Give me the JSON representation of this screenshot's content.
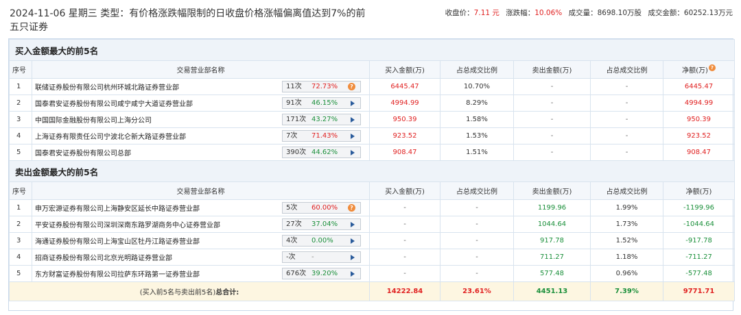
{
  "header": {
    "title": "2024-11-06 星期三 类型：有价格涨跌幅限制的日收盘价格涨幅偏离值达到7%的前五只证券",
    "close_label": "收盘价：",
    "close_value": "7.11 元",
    "change_label": "涨跌幅：",
    "change_value": "10.06%",
    "volume_label": "成交量：",
    "volume_value": "8698.10万股",
    "amount_label": "成交金额：",
    "amount_value": "60252.13万元"
  },
  "columns": {
    "idx": "序号",
    "dept": "交易营业部名称",
    "buy": "买入金额(万)",
    "buy_ratio": "占总成交比例",
    "sell": "卖出金额(万)",
    "sell_ratio": "占总成交比例",
    "net": "净额(万)"
  },
  "buy_section": {
    "title": "买入金额最大的前5名",
    "rows": [
      {
        "idx": "1",
        "dept": "联储证券股份有限公司杭州环城北路证券营业部",
        "cnt": "11次",
        "pct": "72.73%",
        "buy": "6445.47",
        "buy_ratio": "10.70%",
        "sell": "-",
        "sell_ratio": "-",
        "net": "6445.47"
      },
      {
        "idx": "2",
        "dept": "国泰君安证券股份有限公司咸宁咸宁大道证券营业部",
        "cnt": "91次",
        "pct": "46.15%",
        "buy": "4994.99",
        "buy_ratio": "8.29%",
        "sell": "-",
        "sell_ratio": "-",
        "net": "4994.99"
      },
      {
        "idx": "3",
        "dept": "中国国际金融股份有限公司上海分公司",
        "cnt": "171次",
        "pct": "43.27%",
        "buy": "950.39",
        "buy_ratio": "1.58%",
        "sell": "-",
        "sell_ratio": "-",
        "net": "950.39"
      },
      {
        "idx": "4",
        "dept": "上海证券有限责任公司宁波北仑新大路证券营业部",
        "cnt": "7次",
        "pct": "71.43%",
        "buy": "923.52",
        "buy_ratio": "1.53%",
        "sell": "-",
        "sell_ratio": "-",
        "net": "923.52"
      },
      {
        "idx": "5",
        "dept": "国泰君安证券股份有限公司总部",
        "cnt": "390次",
        "pct": "44.62%",
        "buy": "908.47",
        "buy_ratio": "1.51%",
        "sell": "-",
        "sell_ratio": "-",
        "net": "908.47"
      }
    ]
  },
  "sell_section": {
    "title": "卖出金额最大的前5名",
    "rows": [
      {
        "idx": "1",
        "dept": "申万宏源证券有限公司上海静安区延长中路证券营业部",
        "cnt": "5次",
        "pct": "60.00%",
        "buy": "-",
        "buy_ratio": "-",
        "sell": "1199.96",
        "sell_ratio": "1.99%",
        "net": "-1199.96"
      },
      {
        "idx": "2",
        "dept": "平安证券股份有限公司深圳深南东路罗湖商务中心证券营业部",
        "cnt": "27次",
        "pct": "37.04%",
        "buy": "-",
        "buy_ratio": "-",
        "sell": "1044.64",
        "sell_ratio": "1.73%",
        "net": "-1044.64"
      },
      {
        "idx": "3",
        "dept": "海通证券股份有限公司上海宝山区牡丹江路证券营业部",
        "cnt": "4次",
        "pct": "0.00%",
        "buy": "-",
        "buy_ratio": "-",
        "sell": "917.78",
        "sell_ratio": "1.52%",
        "net": "-917.78"
      },
      {
        "idx": "4",
        "dept": "招商证券股份有限公司北京光明路证券营业部",
        "cnt": "-次",
        "pct": "-",
        "buy": "-",
        "buy_ratio": "-",
        "sell": "711.27",
        "sell_ratio": "1.18%",
        "net": "-711.27"
      },
      {
        "idx": "5",
        "dept": "东方财富证券股份有限公司拉萨东环路第一证券营业部",
        "cnt": "676次",
        "pct": "39.20%",
        "buy": "-",
        "buy_ratio": "-",
        "sell": "577.48",
        "sell_ratio": "0.96%",
        "net": "-577.48"
      }
    ]
  },
  "total": {
    "label_prefix": "(买入前5名与卖出前5名)",
    "label_bold": "总合计:",
    "buy": "14222.84",
    "buy_ratio": "23.61%",
    "sell": "4451.13",
    "sell_ratio": "7.39%",
    "net": "9771.71"
  },
  "colors": {
    "up": "#e02020",
    "down": "#1a8f3a",
    "section_bg": "#eef3f9",
    "total_bg": "#fdf6e1"
  },
  "icons": {
    "question": "question-circle-icon",
    "expand": "play-arrow-icon"
  }
}
